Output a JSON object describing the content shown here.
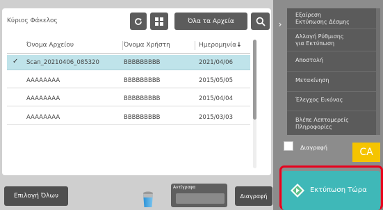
{
  "header": {
    "folder_title": "Κύριος Φάκελος",
    "all_files_label": "Όλα τα Αρχεία"
  },
  "icons": {
    "refresh": "refresh-icon",
    "grid": "grid-icon",
    "search": "search-icon",
    "trash": "trash-icon",
    "print": "print-start-icon"
  },
  "table": {
    "columns": [
      "Όνομα Αρχείου",
      "Όνομα Χρήστη",
      "Ημερομηνία"
    ],
    "sort_indicator": "↓",
    "rows": [
      {
        "file": "Scan_20210406_085320",
        "user": "BBBBBBBBB",
        "date": "2021/04/06",
        "selected": true
      },
      {
        "file": "AAAAAAAA",
        "user": "BBBBBBBBB",
        "date": "2015/05/05",
        "selected": false
      },
      {
        "file": "AAAAAAAA",
        "user": "BBBBBBBBB",
        "date": "2015/04/04",
        "selected": false
      },
      {
        "file": "AAAAAAAA",
        "user": "BBBBBBBBB",
        "date": "2015/03/03",
        "selected": false
      }
    ]
  },
  "bottom": {
    "select_all": "Επιλογή Όλων",
    "copies_label": "Αντίγραφα",
    "delete": "Διαγραφή"
  },
  "side": {
    "items": [
      "Εξαίρεση\nΕκτύπωσης Δέσμης",
      "Αλλαγή Ρύθμισης\nγια Εκτύπωση",
      "Αποστολή",
      "Μετακίνηση",
      "Έλεγχος Εικόνας",
      "Βλέπε Λεπτομερείς\nΠληροφορίες"
    ],
    "delete_checkbox_label": "Διαγραφή",
    "ca_label": "CA",
    "print_now_label": "Εκτύπωση Τώρα"
  },
  "colors": {
    "selected_row": "#bfe3ea",
    "print_button": "#3fb8b8",
    "highlight_border": "#e8001c",
    "ca_button": "#f5c400"
  }
}
